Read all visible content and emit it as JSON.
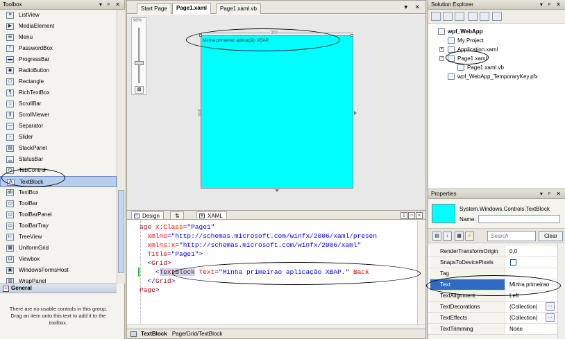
{
  "toolbox": {
    "title": "Toolbox",
    "controls": "▾ ᵖ ✕",
    "items": [
      {
        "label": "ListView",
        "icon": "listview-icon",
        "glyph": "≡"
      },
      {
        "label": "MediaElement",
        "icon": "mediaelement-icon",
        "glyph": "▶"
      },
      {
        "label": "Menu",
        "icon": "menu-icon",
        "glyph": "☰"
      },
      {
        "label": "PasswordBox",
        "icon": "passwordbox-icon",
        "glyph": "*"
      },
      {
        "label": "ProgressBar",
        "icon": "progressbar-icon",
        "glyph": "▬"
      },
      {
        "label": "RadioButton",
        "icon": "radiobutton-icon",
        "glyph": "◉"
      },
      {
        "label": "Rectangle",
        "icon": "rectangle-icon",
        "glyph": "□"
      },
      {
        "label": "RichTextBox",
        "icon": "richtextbox-icon",
        "glyph": "¶"
      },
      {
        "label": "ScrollBar",
        "icon": "scrollbar-icon",
        "glyph": "↕"
      },
      {
        "label": "ScrollViewer",
        "icon": "scrollviewer-icon",
        "glyph": "⇕"
      },
      {
        "label": "Separator",
        "icon": "separator-icon",
        "glyph": "—"
      },
      {
        "label": "Slider",
        "icon": "slider-icon",
        "glyph": "◦"
      },
      {
        "label": "StackPanel",
        "icon": "stackpanel-icon",
        "glyph": "▤"
      },
      {
        "label": "StatusBar",
        "icon": "statusbar-icon",
        "glyph": "▁"
      },
      {
        "label": "TabControl",
        "icon": "tabcontrol-icon",
        "glyph": "⊓"
      },
      {
        "label": "TextBlock",
        "icon": "textblock-icon",
        "glyph": "A",
        "selected": true
      },
      {
        "label": "TextBox",
        "icon": "textbox-icon",
        "glyph": "ab"
      },
      {
        "label": "ToolBar",
        "icon": "toolbar-icon",
        "glyph": "▭"
      },
      {
        "label": "ToolBarPanel",
        "icon": "toolbarpanel-icon",
        "glyph": "▭"
      },
      {
        "label": "ToolBarTray",
        "icon": "toolbartray-icon",
        "glyph": "▭"
      },
      {
        "label": "TreeView",
        "icon": "treeview-icon",
        "glyph": "⊢"
      },
      {
        "label": "UniformGrid",
        "icon": "uniformgrid-icon",
        "glyph": "▦"
      },
      {
        "label": "Viewbox",
        "icon": "viewbox-icon",
        "glyph": "⊡"
      },
      {
        "label": "WindowsFormsHost",
        "icon": "windowsformshost-icon",
        "glyph": "▣"
      },
      {
        "label": "WrapPanel",
        "icon": "wrappanel-icon",
        "glyph": "▥"
      }
    ],
    "general_header": "General",
    "general_toggle": "−",
    "general_note": "There are no usable controls in this group. Drag an item onto this text to add it to the toolbox."
  },
  "editor": {
    "tabs": [
      {
        "label": "Start Page",
        "active": false
      },
      {
        "label": "Page1.xaml",
        "active": true
      },
      {
        "label": "Page1.xaml.vb",
        "active": false
      }
    ],
    "tab_controls": "▾ ✕",
    "zoom_label": "90%",
    "design": {
      "ruler_top": "300",
      "ruler_left": "300",
      "textblock_text": "Minha primeirao aplicação XBAP.",
      "grid_fill": "#00ffff"
    },
    "split": {
      "design_tab": "Design",
      "swap_tab": "⇅",
      "xaml_tab": "XAML",
      "controls": [
        "▯",
        "▭",
        "«"
      ]
    },
    "code": [
      [
        {
          "t": "age ",
          "c": "maroon"
        },
        {
          "t": "x:Class",
          "c": "red"
        },
        {
          "t": "=\"Page1\"",
          "c": "blue"
        }
      ],
      [
        {
          "t": "  xmlns",
          "c": "red"
        },
        {
          "t": "=\"http://schemas.microsoft.com/winfx/2006/xaml/presen",
          "c": "blue"
        }
      ],
      [
        {
          "t": "  xmlns:x",
          "c": "red"
        },
        {
          "t": "=\"http://schemas.microsoft.com/winfx/2006/xaml\"",
          "c": "blue"
        }
      ],
      [
        {
          "t": "  Title",
          "c": "red"
        },
        {
          "t": "=\"Page1\">",
          "c": "blue"
        }
      ],
      [
        {
          "t": "  <",
          "c": "blue"
        },
        {
          "t": "Grid",
          "c": "maroon"
        },
        {
          "t": ">",
          "c": "blue"
        }
      ],
      [
        {
          "t": "    <",
          "c": "blue"
        },
        {
          "t": "TextBlock",
          "c": "hl"
        },
        {
          "t": " Text",
          "c": "red"
        },
        {
          "t": "=\"Minha primeirao aplicação XBAP.\" ",
          "c": "blue"
        },
        {
          "t": "Back",
          "c": "red"
        }
      ],
      [
        {
          "t": "  </",
          "c": "blue"
        },
        {
          "t": "Grid",
          "c": "maroon"
        },
        {
          "t": ">",
          "c": "blue"
        }
      ],
      [
        {
          "t": "Page",
          "c": "maroon"
        },
        {
          "t": ">",
          "c": "blue"
        }
      ]
    ],
    "breadcrumb": {
      "current": "TextBlock",
      "path": "Page/Grid/TextBlock"
    }
  },
  "solution_explorer": {
    "title": "Solution Explorer",
    "controls": "▾ ᵖ ✕",
    "tree": [
      {
        "label": "wpf_WebApp",
        "bold": true,
        "icon": "project-icon",
        "depth": 0
      },
      {
        "label": "My Project",
        "icon": "my-project-icon",
        "depth": 1
      },
      {
        "label": "Application.xaml",
        "icon": "xaml-file-icon",
        "depth": 1,
        "expander": "+"
      },
      {
        "label": "Page1.xaml",
        "icon": "xaml-file-icon",
        "depth": 1,
        "expander": "−"
      },
      {
        "label": "Page1.xaml.vb",
        "icon": "vb-file-icon",
        "depth": 2
      },
      {
        "label": "wpf_WebApp_TemporaryKey.pfx",
        "icon": "key-file-icon",
        "depth": 1
      }
    ]
  },
  "properties": {
    "title": "Properties",
    "controls": "▾ ᵖ ✕",
    "type_name": "System.Windows.Controls.TextBlock",
    "name_label": "Name:",
    "name_value": "",
    "search_placeholder": "Search",
    "clear_label": "Clear",
    "rows": [
      {
        "name": "RenderTransformOrigin",
        "value": "0,0"
      },
      {
        "name": "SnapsToDevicePixels",
        "value": "",
        "checkbox": true
      },
      {
        "name": "Tag",
        "value": ""
      },
      {
        "name": "Text",
        "value": "Minha primeirao",
        "selected": true
      },
      {
        "name": "TextAlignment",
        "value": "Left"
      },
      {
        "name": "TextDecorations",
        "value": "(Collection)",
        "ellipsis": "..."
      },
      {
        "name": "TextEffects",
        "value": "(Collection)",
        "ellipsis": "..."
      },
      {
        "name": "TextTrimming",
        "value": "None"
      }
    ]
  },
  "colors": {
    "canvas_cyan": "#00ffff",
    "selection_blue": "#316ac5",
    "xaml_attr_red": "#ff0000",
    "xaml_value_blue": "#0000ff",
    "xaml_tag_maroon": "#a31515"
  }
}
